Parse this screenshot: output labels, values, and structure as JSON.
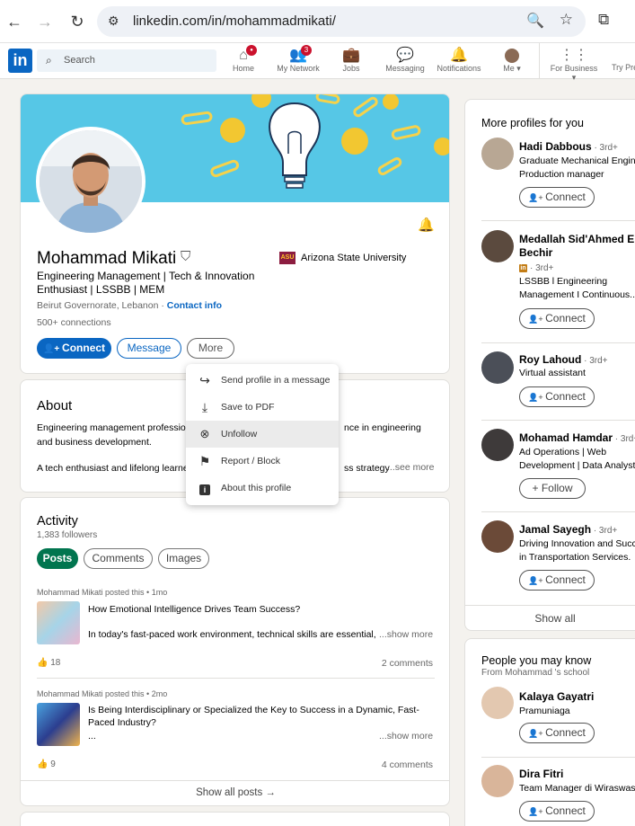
{
  "browser": {
    "url": "linkedin.com/in/mohammadmikati/"
  },
  "topnav": {
    "logo": "in",
    "search_placeholder": "Search",
    "items": [
      {
        "label": "Home",
        "badge": "●"
      },
      {
        "label": "My Network",
        "badge": "3"
      },
      {
        "label": "Jobs",
        "badge": ""
      },
      {
        "label": "Messaging",
        "badge": ""
      },
      {
        "label": "Notifications",
        "badge": ""
      },
      {
        "label": "Me ▾",
        "badge": ""
      }
    ],
    "for_business": "For Business ▾",
    "try_premium": "Try Pre"
  },
  "profile": {
    "name": "Mohammad Mikati",
    "headline": "Engineering Management | Tech & Innovation Enthusiast | LSSBB | MEM",
    "location": "Beirut Governorate, Lebanon · ",
    "contact": "Contact info",
    "connections": "500+ connections",
    "school": "Arizona State University",
    "school_logo": "ASU",
    "buttons": {
      "connect": "Connect",
      "message": "Message",
      "more": "More"
    }
  },
  "dropdown": [
    {
      "label": "Send profile in a message",
      "icon": "share-arrow-icon"
    },
    {
      "label": "Save to PDF",
      "icon": "download-icon"
    },
    {
      "label": "Unfollow",
      "icon": "close-circle-icon"
    },
    {
      "label": "Report / Block",
      "icon": "flag-icon"
    },
    {
      "label": "About this profile",
      "icon": "info-icon"
    }
  ],
  "about": {
    "title": "About",
    "line1_left": "Engineering management professio",
    "line1_right": "nce in engineering",
    "line2": "and business development.",
    "line3_left": "A tech enthusiast and lifelong learne",
    "line3_right": "ss strategy",
    "see_more": "...see more"
  },
  "activity": {
    "title": "Activity",
    "followers": "1,383 followers",
    "tabs": [
      "Posts",
      "Comments",
      "Images"
    ],
    "posts": [
      {
        "meta": "Mohammad Mikati posted this • 1mo",
        "title": "How Emotional Intelligence Drives Team Success?",
        "excerpt": "In today's fast-paced work environment, technical skills are essential,",
        "show_more": "...show more",
        "reactions": "18",
        "comments": "2 comments"
      },
      {
        "meta": "Mohammad Mikati posted this • 2mo",
        "title": "Is Being Interdisciplinary or Specialized the Key to Success in a Dynamic, Fast-Paced Industry?",
        "excerpt": "...",
        "show_more": "...show more",
        "reactions": "9",
        "comments": "4 comments"
      }
    ],
    "show_all": "Show all posts →"
  },
  "more_profiles": {
    "title": "More profiles for you",
    "people": [
      {
        "name": "Hadi Dabbous",
        "degree": " · 3rd+",
        "headline1": "Graduate Mechanical Engine",
        "headline2": "Production manager",
        "button": "Connect"
      },
      {
        "name": "Medallah Sid'Ahmed El Bechir",
        "degree": "· 3rd+",
        "headline1": "LSSBB l Engineering",
        "headline2": "Management I Continuous...",
        "button": "Connect"
      },
      {
        "name": "Roy Lahoud",
        "degree": " · 3rd+",
        "headline1": "Virtual assistant",
        "headline2": "",
        "button": "Connect"
      },
      {
        "name": "Mohamad Hamdar",
        "degree": " · 3rd+",
        "headline1": "Ad Operations | Web",
        "headline2": "Development | Data Analyst",
        "button": "Follow"
      },
      {
        "name": "Jamal Sayegh",
        "degree": " · 3rd+",
        "headline1": "Driving Innovation and Succ",
        "headline2": "in Transportation Services.",
        "button": "Connect"
      }
    ],
    "show_all": "Show all"
  },
  "people_may_know": {
    "title": "People you may know",
    "subtitle": "From Mohammad 's school",
    "people": [
      {
        "name": "Kalaya Gayatri",
        "headline": "Pramuniaga",
        "button": "Connect"
      },
      {
        "name": "Dira Fitri",
        "headline": "Team Manager di Wiraswast",
        "button": "Connect"
      }
    ]
  },
  "colors": {
    "linkedin_blue": "#0a66c2",
    "posts_green": "#01754f",
    "banner": "#56c7e6"
  }
}
